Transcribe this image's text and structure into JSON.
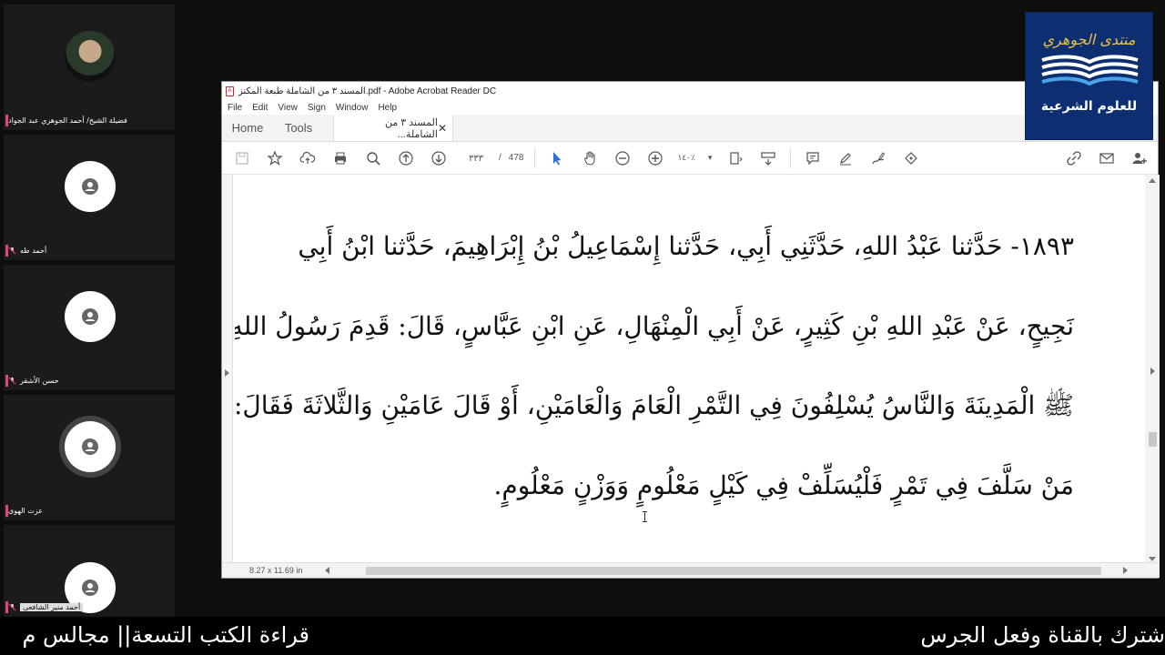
{
  "participants": [
    {
      "name": "فضيلة الشيخ/ أحمد الجوهري عبد الجواد",
      "avatar": "photo"
    },
    {
      "name": "أحمد طه",
      "avatar": "user-icon"
    },
    {
      "name": "حسن الأشقر",
      "avatar": "user-icon"
    },
    {
      "name": "عزت الهوى",
      "avatar": "user-icon"
    },
    {
      "name": "أحمد منير الشافعى",
      "avatar": "user-icon"
    }
  ],
  "window": {
    "title": "المسند ٣ من الشاملة طبعة المكنز.pdf - Adobe Acrobat Reader DC",
    "menu": [
      "File",
      "Edit",
      "View",
      "Sign",
      "Window",
      "Help"
    ],
    "tabs": {
      "home": "Home",
      "tools": "Tools",
      "document": "المسند ٣ من الشاملة..."
    },
    "page_current": "٣٣٣",
    "page_sep": "/",
    "page_total": "478",
    "zoom": "١٤٠٪",
    "page_size": "8.27 x 11.69 in"
  },
  "document_lines": [
    "١٨٩٣- حَدَّثنا عَبْدُ اللهِ، حَدَّثَنِي أَبِي، حَدَّثنا إِسْمَاعِيلُ بْنُ إِبْرَاهِيمَ، حَدَّثنا ابْنُ أَبِي",
    "نَجِيحٍ، عَنْ عَبْدِ اللهِ بْنِ كَثِيرٍ، عَنْ أَبِي الْمِنْهَالِ، عَنِ ابْنِ عَبَّاسٍ، قَالَ: قَدِمَ رَسُولُ اللهِ",
    "ﷺ الْمَدِينَةَ وَالنَّاسُ يُسْلِفُونَ فِي التَّمْرِ الْعَامَ وَالْعَامَيْنِ، أَوْ قَالَ عَامَيْنِ وَالثَّلاثَةَ فَقَالَ:",
    "مَنْ سَلَّفَ فِي تَمْرٍ فَلْيُسَلِّفْ فِي كَيْلٍ مَعْلُومٍ وَوَزْنٍ مَعْلُومٍ."
  ],
  "logo": {
    "line1": "منتدى الجوهري",
    "line2": "للعلوم الشرعية"
  },
  "ticker": {
    "left": "قراءة الكتب التسعة|| مجالس م",
    "right": "شترك بالقناة وفعل الجرس"
  },
  "colors": {
    "accent_pink": "#e0457b",
    "logo_bg": "#0d2f72",
    "logo_gold": "#e8c14a",
    "tool_blue": "#2b6fd6"
  }
}
